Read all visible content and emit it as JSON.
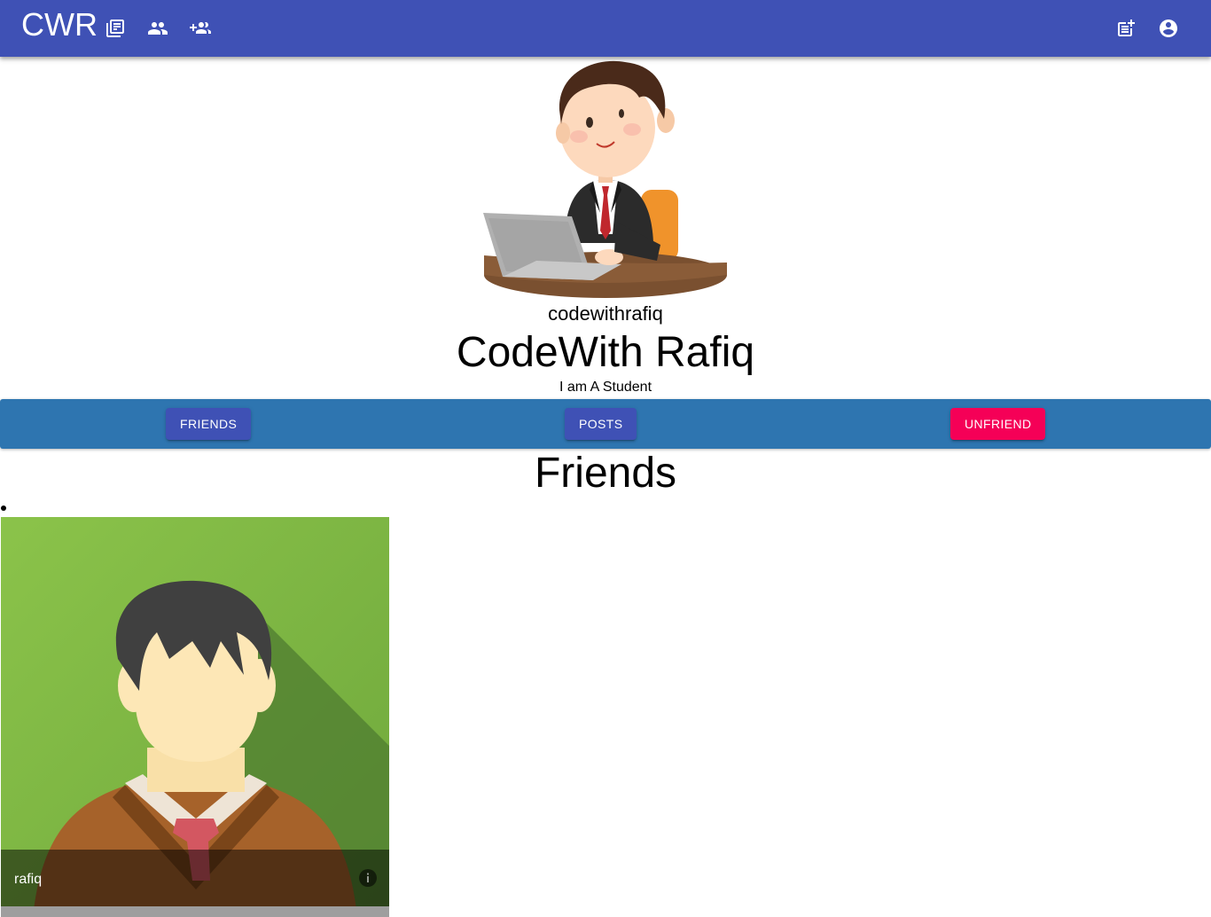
{
  "appbar": {
    "brand": "CWR",
    "color": "#3f51b5",
    "nav_icons": [
      "collections-icon",
      "people-icon",
      "group-add-icon"
    ],
    "right_icons": [
      "post-add-icon",
      "account-circle-icon"
    ]
  },
  "profile": {
    "avatar": "businessman-at-laptop-illustration",
    "username": "codewithrafiq",
    "full_name": "CodeWith Rafiq",
    "bio": "I am A Student"
  },
  "actions": {
    "strip_color": "#2e75b0",
    "friends_label": "FRIENDS",
    "posts_label": "POSTS",
    "unfriend_label": "UNFRIEND",
    "primary_color": "#3f51b5",
    "secondary_color": "#f50057"
  },
  "friends_section": {
    "title": "Friends",
    "items": [
      {
        "name": "rafiq",
        "avatar": "male-avatar-green-background",
        "info_icon": "info-icon"
      }
    ]
  }
}
